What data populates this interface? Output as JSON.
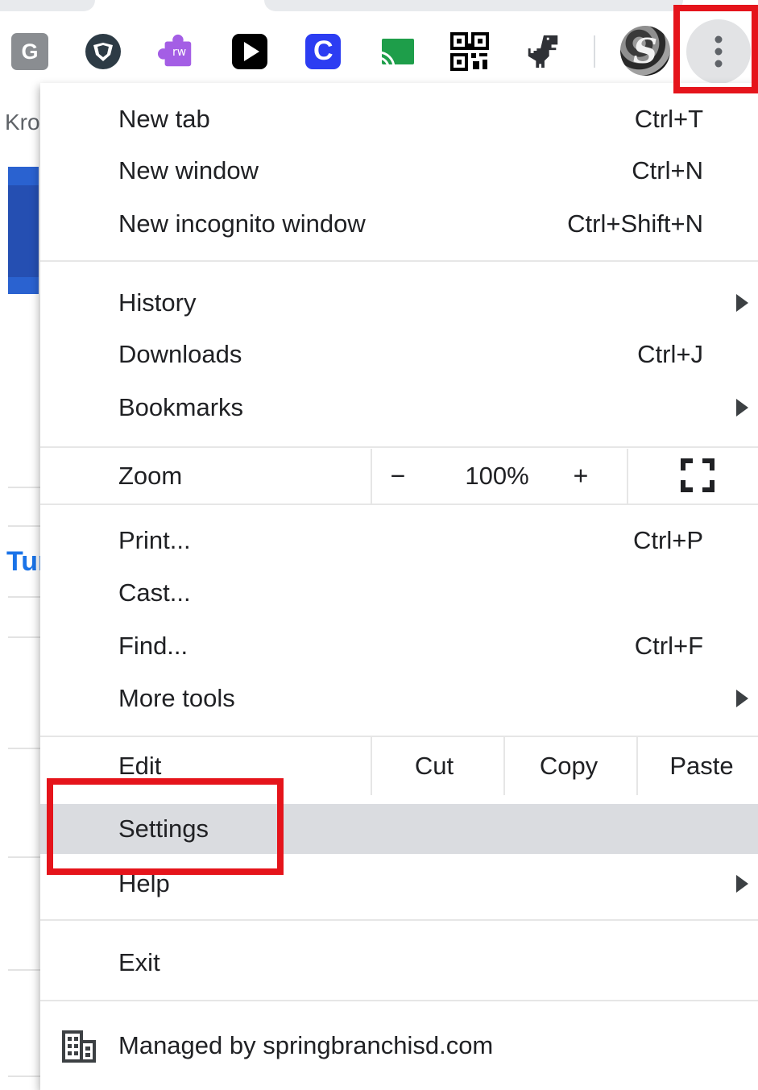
{
  "toolbar": {
    "extensions": [
      {
        "icon": "grammar-g-icon",
        "label": "G"
      },
      {
        "icon": "shield-v-icon"
      },
      {
        "icon": "puzzle-rw-icon",
        "label": "rw"
      },
      {
        "icon": "play-icon"
      },
      {
        "icon": "c-letter-icon",
        "label": "C"
      },
      {
        "icon": "cast-icon"
      },
      {
        "icon": "qr-code-icon"
      },
      {
        "icon": "dinosaur-icon"
      }
    ],
    "profile_initial": "S",
    "menu_icon": "three-dots-vertical-icon"
  },
  "background": {
    "left_text_top": "Kro",
    "left_text_mid": "Tur"
  },
  "menu": {
    "group1": [
      {
        "label": "New tab",
        "shortcut": "Ctrl+T"
      },
      {
        "label": "New window",
        "shortcut": "Ctrl+N"
      },
      {
        "label": "New incognito window",
        "shortcut": "Ctrl+Shift+N"
      }
    ],
    "group2": [
      {
        "label": "History",
        "shortcut": ""
      },
      {
        "label": "Downloads",
        "shortcut": "Ctrl+J"
      },
      {
        "label": "Bookmarks",
        "shortcut": ""
      }
    ],
    "zoom": {
      "label": "Zoom",
      "minus": "−",
      "value": "100%",
      "plus": "+"
    },
    "group3": [
      {
        "label": "Print...",
        "shortcut": "Ctrl+P"
      },
      {
        "label": "Cast...",
        "shortcut": ""
      },
      {
        "label": "Find...",
        "shortcut": "Ctrl+F"
      },
      {
        "label": "More tools",
        "shortcut": ""
      }
    ],
    "edit": {
      "label": "Edit",
      "cut": "Cut",
      "copy": "Copy",
      "paste": "Paste"
    },
    "settings": {
      "label": "Settings"
    },
    "help": {
      "label": "Help"
    },
    "exit": {
      "label": "Exit"
    },
    "managed": {
      "label": "Managed by springbranchisd.com"
    }
  },
  "colors": {
    "annotation": "#e5141b",
    "highlight": "#dadce0",
    "text": "#202124"
  }
}
